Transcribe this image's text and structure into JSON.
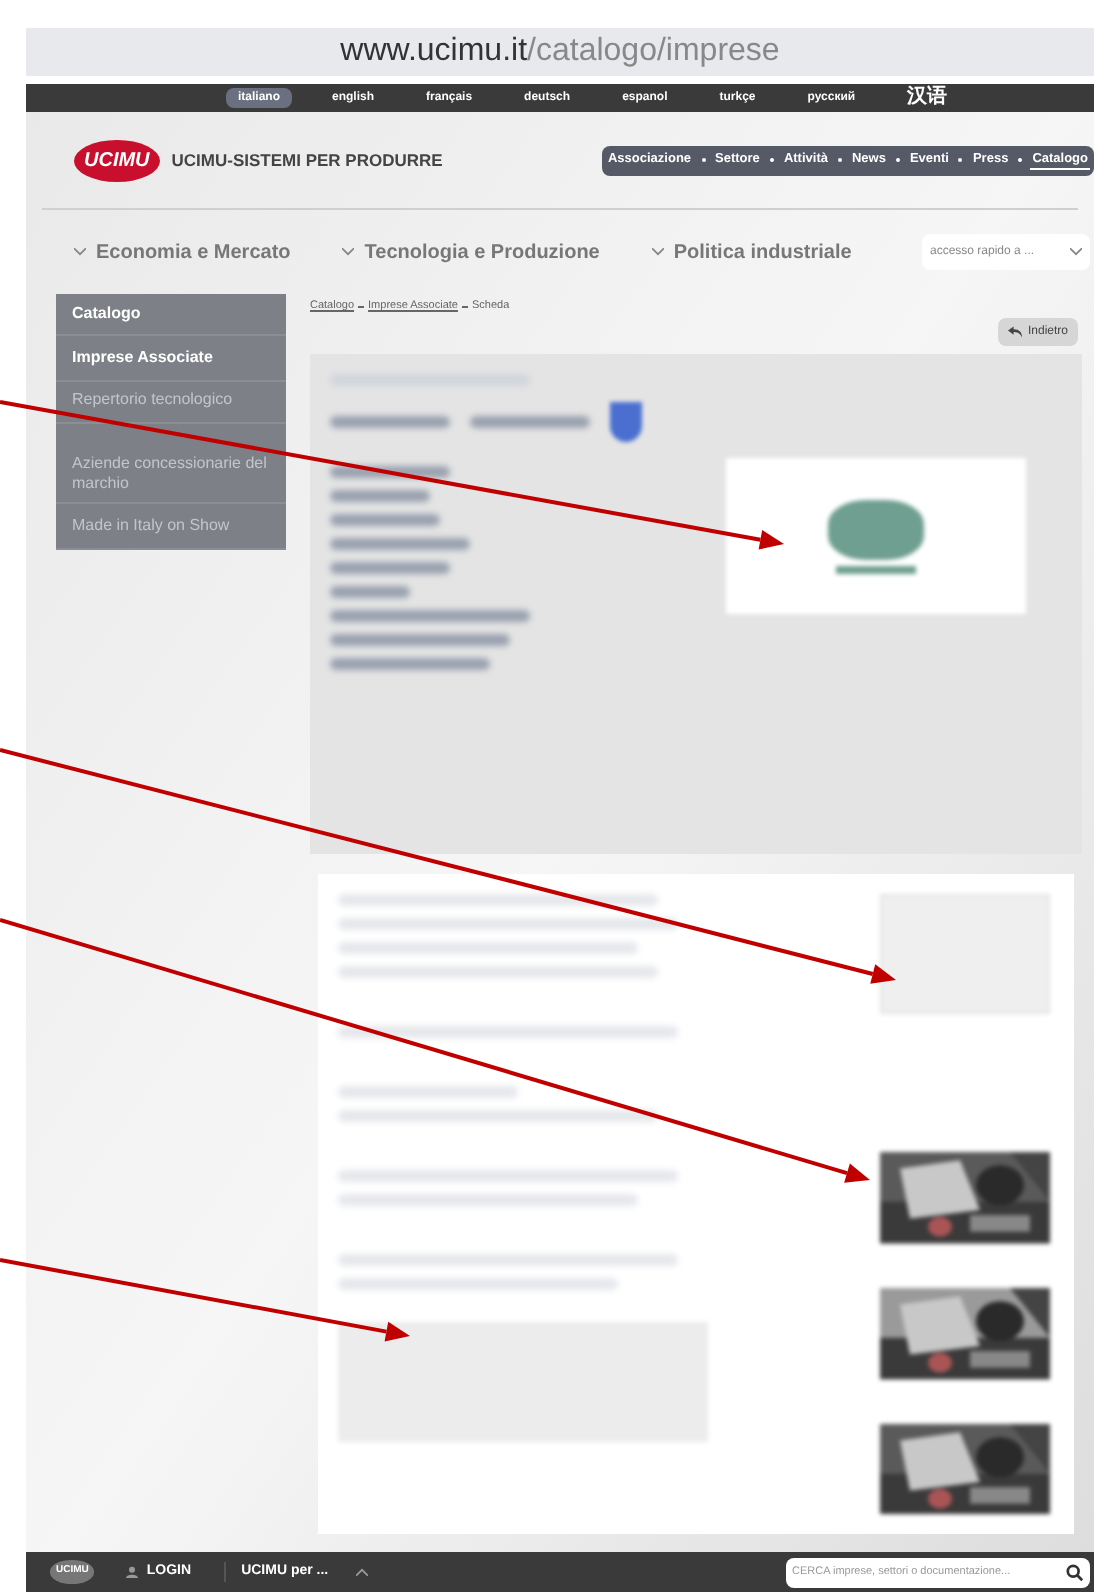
{
  "address_bar": {
    "host": "www.ucimu.it",
    "path": "/catalogo/imprese"
  },
  "languages": [
    {
      "label": "italiano",
      "selected": true
    },
    {
      "label": "english",
      "selected": false
    },
    {
      "label": "français",
      "selected": false
    },
    {
      "label": "deutsch",
      "selected": false
    },
    {
      "label": "espanol",
      "selected": false
    },
    {
      "label": "turkçe",
      "selected": false
    },
    {
      "label": "русский",
      "selected": false
    },
    {
      "label": "汉语",
      "selected": false
    }
  ],
  "header": {
    "logo": "UCIMU",
    "brand": "UCIMU-SISTEMI PER PRODURRE"
  },
  "main_nav": [
    {
      "label": "Associazione",
      "selected": false
    },
    {
      "label": "Settore",
      "selected": false
    },
    {
      "label": "Attività",
      "selected": false
    },
    {
      "label": "News",
      "selected": false
    },
    {
      "label": "Eventi",
      "selected": false
    },
    {
      "label": "Press",
      "selected": false
    },
    {
      "label": "Catalogo",
      "selected": true
    }
  ],
  "topic_nav": [
    "Economia e Mercato",
    "Tecnologia e Produzione",
    "Politica industriale"
  ],
  "quick_access": {
    "placeholder": "accesso rapido a ..."
  },
  "sidebar": {
    "title": "Catalogo",
    "items": [
      {
        "label": "Imprese Associate",
        "selected": true
      },
      {
        "label": "Repertorio tecnologico",
        "selected": false
      },
      {
        "label": "Aziende concessionarie del marchio",
        "selected": false
      },
      {
        "label": "Made in Italy on Show",
        "selected": false
      }
    ]
  },
  "breadcrumb": [
    {
      "label": "Catalogo",
      "link": true
    },
    {
      "label": "Imprese Associate",
      "link": true
    },
    {
      "label": "Scheda",
      "link": false
    }
  ],
  "back_button": "Indietro",
  "footer": {
    "logo": "UCIMU",
    "login": "LOGIN",
    "menu": "UCIMU per ...",
    "search": {
      "placeholder": "CERCA imprese, settori o documentazione..."
    }
  }
}
